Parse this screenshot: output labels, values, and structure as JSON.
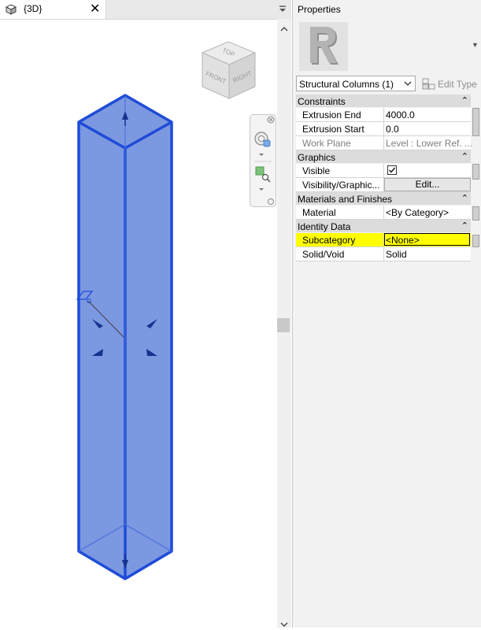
{
  "view": {
    "tab_title": "{3D}",
    "close_glyph": "✕",
    "menu_glyph": "▾",
    "viewcube": {
      "top": "TOP",
      "front": "FRONT",
      "right": "RIGHT"
    },
    "column_color": "#1f4bd8",
    "column_fill": "#7b98e0"
  },
  "properties": {
    "title": "Properties",
    "type_selector": "Structural Columns (1)",
    "edit_type": "Edit Type",
    "categories": [
      {
        "label": "Constraints",
        "rows": [
          {
            "name": "Extrusion End",
            "value": "4000.0"
          },
          {
            "name": "Extrusion Start",
            "value": "0.0"
          },
          {
            "name": "Work Plane",
            "value": "Level : Lower Ref. ..."
          }
        ]
      },
      {
        "label": "Graphics",
        "rows": [
          {
            "name": "Visible",
            "value": "checked"
          },
          {
            "name": "Visibility/Graphic...",
            "value": "Edit..."
          }
        ]
      },
      {
        "label": "Materials and Finishes",
        "rows": [
          {
            "name": "Material",
            "value": "<By Category>"
          }
        ]
      },
      {
        "label": "Identity Data",
        "rows": [
          {
            "name": "Subcategory",
            "value": "<None>"
          },
          {
            "name": "Solid/Void",
            "value": "Solid"
          }
        ]
      }
    ],
    "collapse_glyph": "⌃"
  }
}
